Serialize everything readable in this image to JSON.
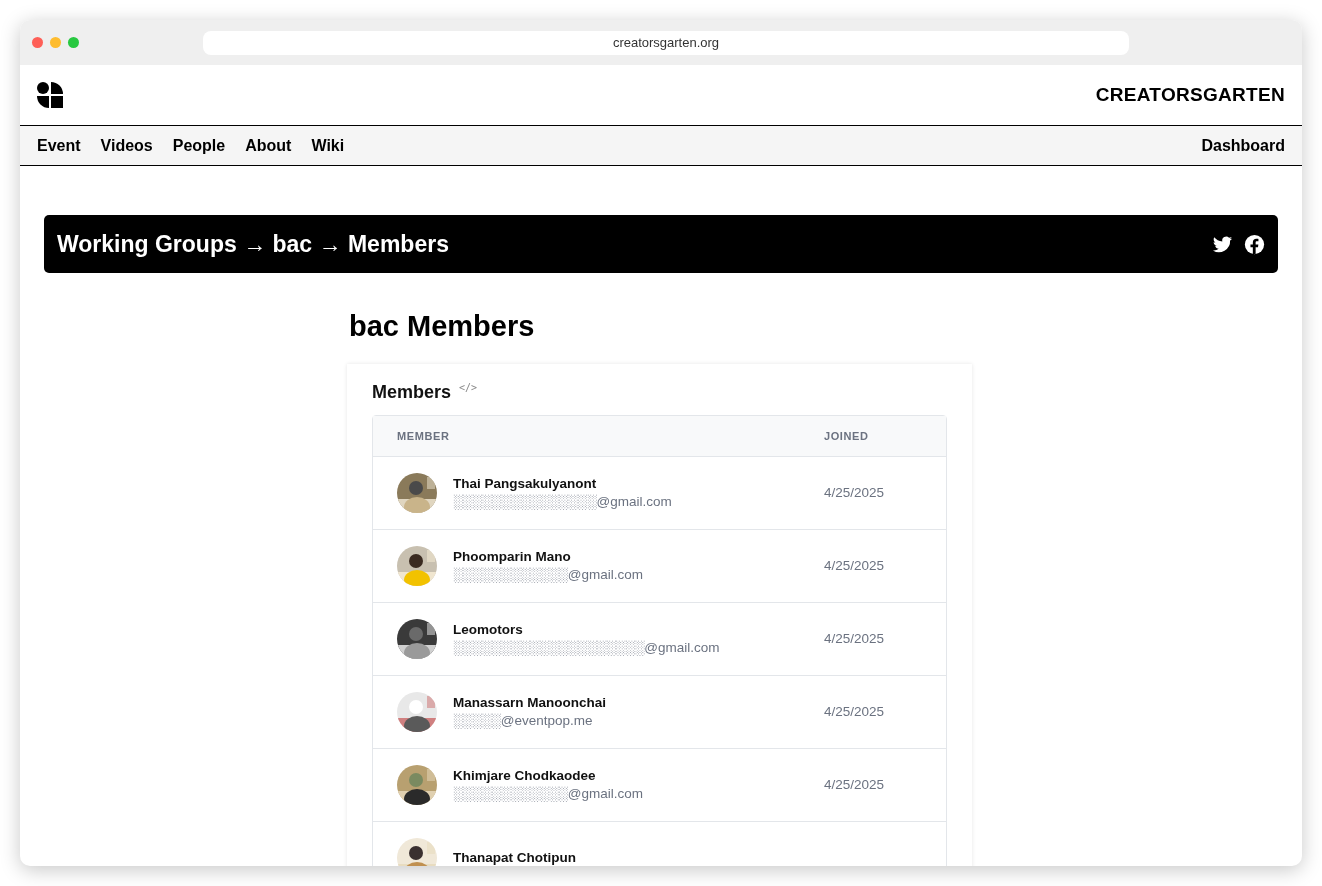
{
  "browser": {
    "url": "creatorsgarten.org"
  },
  "site": {
    "brand": "CREATORSGARTEN",
    "nav": [
      {
        "label": "Event"
      },
      {
        "label": "Videos"
      },
      {
        "label": "People"
      },
      {
        "label": "About"
      },
      {
        "label": "Wiki"
      }
    ],
    "nav_right": {
      "label": "Dashboard"
    }
  },
  "banner": {
    "title": "Working Groups → bac → Members"
  },
  "heading": "bac Members",
  "card": {
    "title": "Members",
    "code_icon": "</>",
    "table": {
      "columns": [
        "MEMBER",
        "JOINED"
      ],
      "rows": [
        {
          "name": "Thai Pangsakulyanont",
          "email": "░░░░░░░░░░░░░░░@gmail.com",
          "joined": "4/25/2025"
        },
        {
          "name": "Phoomparin Mano",
          "email": "░░░░░░░░░░░░@gmail.com",
          "joined": "4/25/2025"
        },
        {
          "name": "Leomotors",
          "email": "░░░░░░░░░░░░░░░░░░░░@gmail.com",
          "joined": "4/25/2025"
        },
        {
          "name": "Manassarn Manoonchai",
          "email": "░░░░░@eventpop.me",
          "joined": "4/25/2025"
        },
        {
          "name": "Khimjare Chodkaodee",
          "email": "░░░░░░░░░░░░@gmail.com",
          "joined": "4/25/2025"
        },
        {
          "name": "Thanapat Chotipun"
        }
      ]
    }
  }
}
